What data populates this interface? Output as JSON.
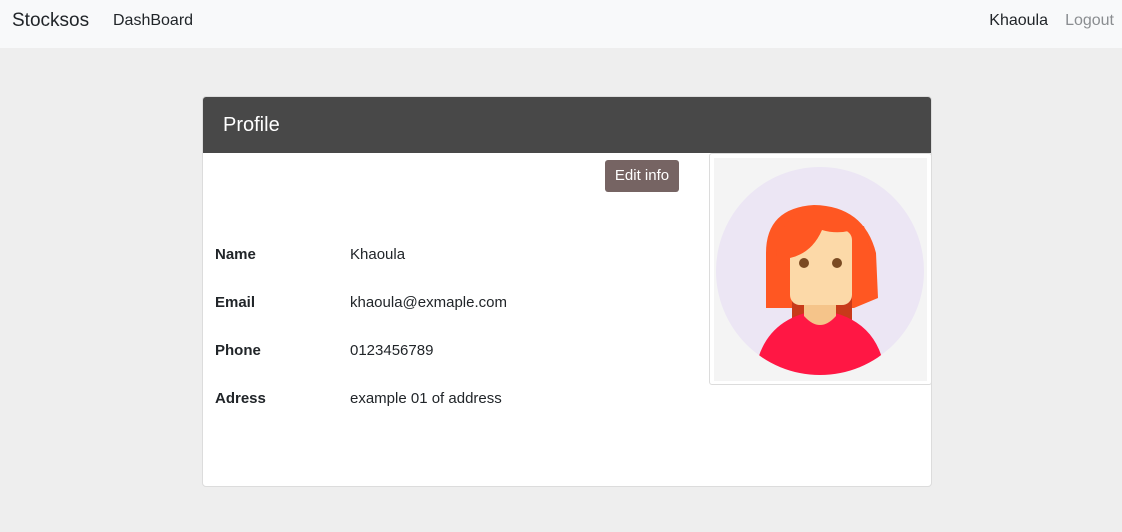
{
  "navbar": {
    "brand": "Stocksos",
    "dashboard_link": "DashBoard",
    "user_name": "Khaoula",
    "logout_link": "Logout"
  },
  "profile": {
    "title": "Profile",
    "edit_button": "Edit info",
    "fields": [
      {
        "label": "Name",
        "value": "Khaoula"
      },
      {
        "label": "Email",
        "value": "khaoula@exmaple.com"
      },
      {
        "label": "Phone",
        "value": "0123456789"
      },
      {
        "label": "Adress",
        "value": "example 01 of address"
      }
    ],
    "avatar_icon": "female-avatar-icon"
  },
  "colors": {
    "navbar_bg": "#f8f9fa",
    "page_bg": "#eeeeee",
    "card_header_bg": "#484848",
    "edit_button_bg": "#766463",
    "avatar_circle": "#ece6f4",
    "avatar_hair": "#ff5722",
    "avatar_shirt": "#ff1744"
  }
}
